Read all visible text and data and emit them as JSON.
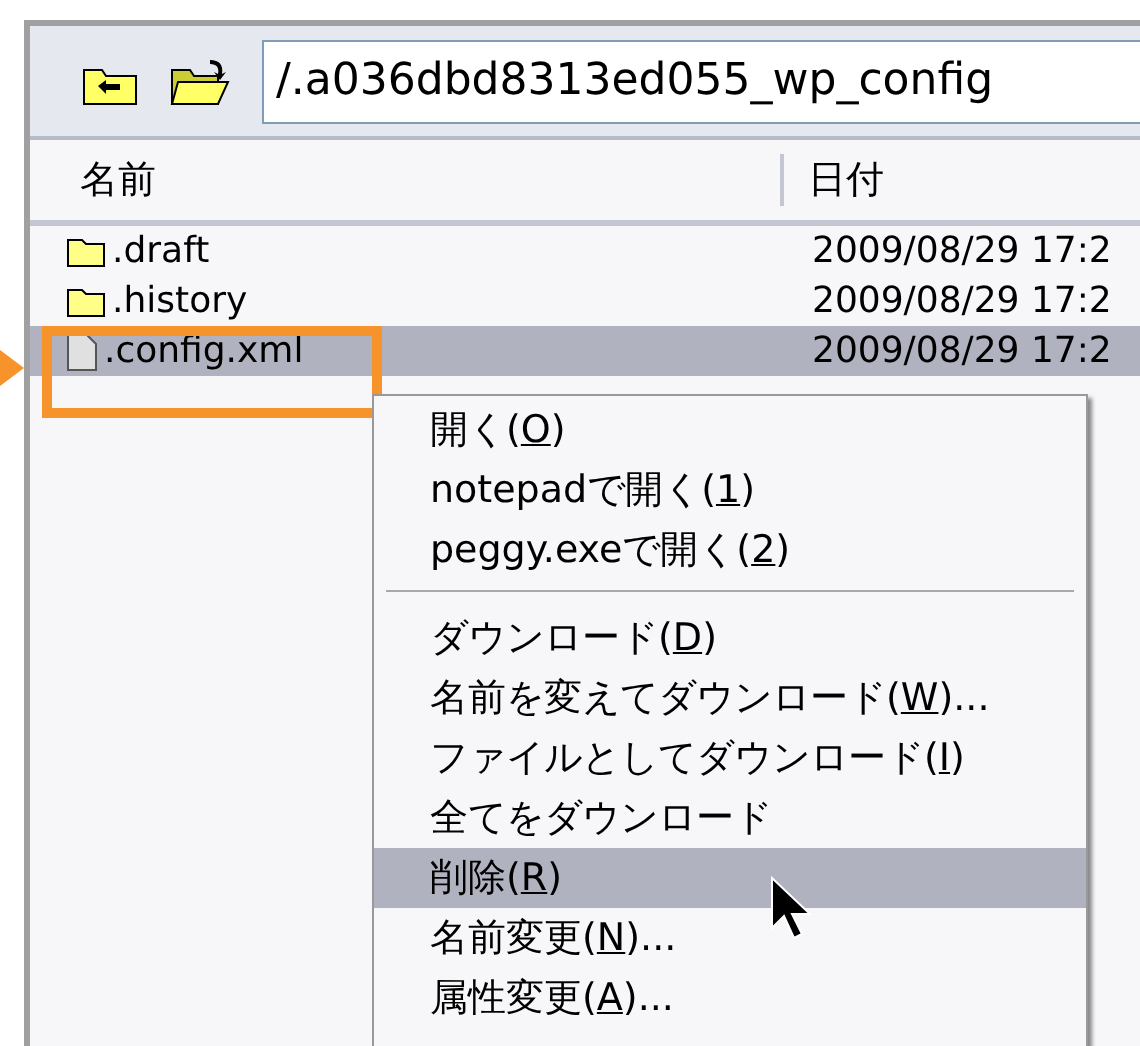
{
  "toolbar": {
    "path": "/.a036dbd8313ed055_wp_config"
  },
  "table": {
    "columns": [
      "名前",
      "日付"
    ],
    "rows": [
      {
        "kind": "folder",
        "name": ".draft",
        "date": "2009/08/29 17:2",
        "selected": false
      },
      {
        "kind": "folder",
        "name": ".history",
        "date": "2009/08/29 17:2",
        "selected": false
      },
      {
        "kind": "file",
        "name": ".config.xml",
        "date": "2009/08/29 17:2",
        "selected": true
      }
    ]
  },
  "context_menu": {
    "groups": [
      [
        {
          "label": "開く(",
          "key": "O",
          "tail": ")",
          "selected": false
        },
        {
          "label": "notepadで開く(",
          "key": "1",
          "tail": ")",
          "selected": false
        },
        {
          "label": "peggy.exeで開く(",
          "key": "2",
          "tail": ")",
          "selected": false
        }
      ],
      [
        {
          "label": "ダウンロード(",
          "key": "D",
          "tail": ")",
          "selected": false
        },
        {
          "label": "名前を変えてダウンロード(",
          "key": "W",
          "tail": ")...",
          "selected": false
        },
        {
          "label": "ファイルとしてダウンロード(",
          "key": "I",
          "tail": ")",
          "selected": false
        },
        {
          "label": "全てをダウンロード",
          "selected": false
        },
        {
          "label": "削除(",
          "key": "R",
          "tail": ")",
          "selected": true
        },
        {
          "label": "名前変更(",
          "key": "N",
          "tail": ")...",
          "selected": false
        },
        {
          "label": "属性変更(",
          "key": "A",
          "tail": ")...",
          "selected": false
        }
      ]
    ]
  }
}
